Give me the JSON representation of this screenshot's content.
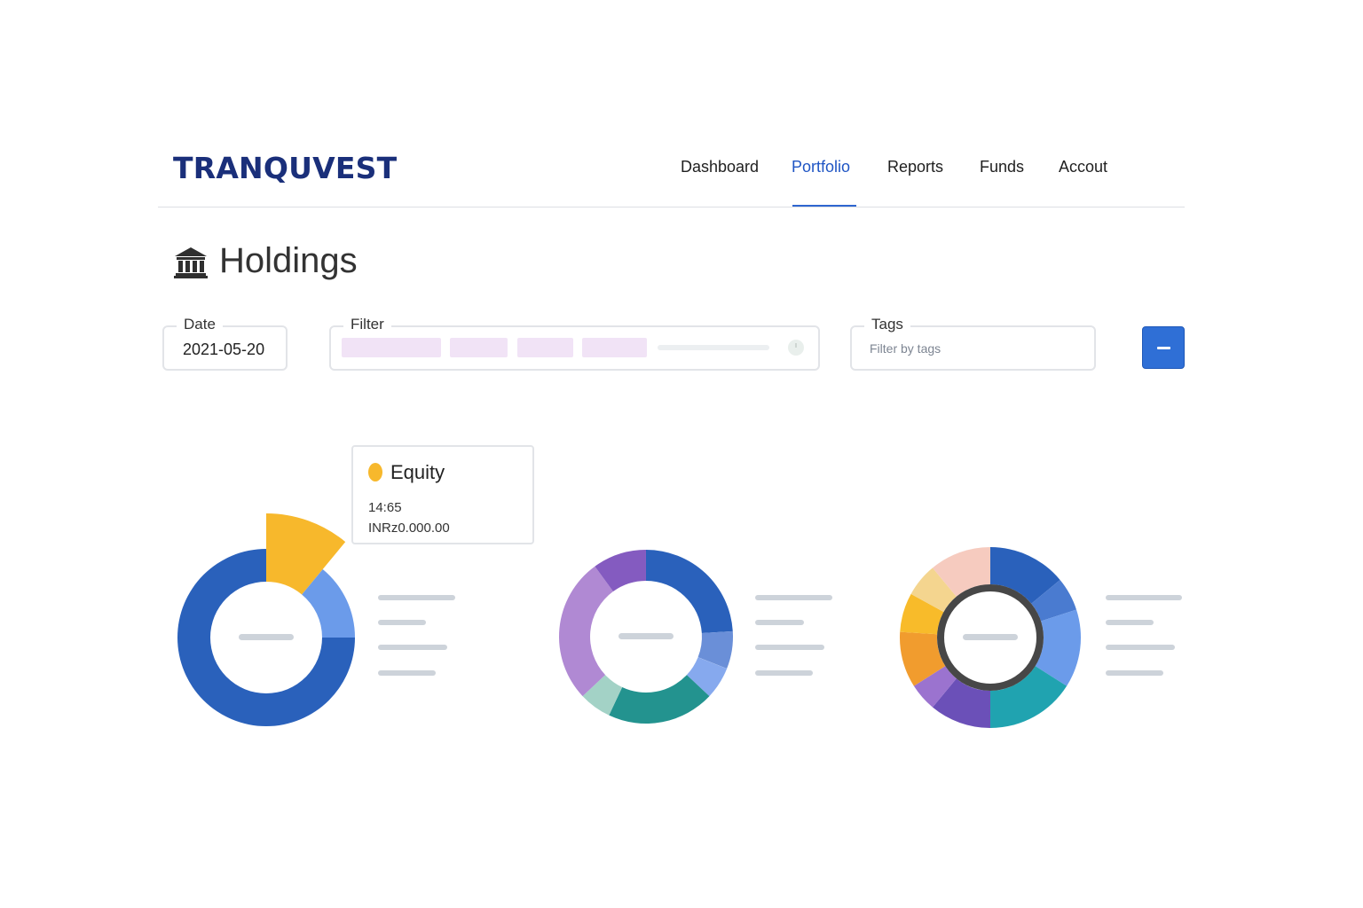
{
  "app": {
    "logo": "TRANQUVEST"
  },
  "nav": {
    "items": [
      {
        "label": "Dashboard",
        "active": false
      },
      {
        "label": "Portfolio",
        "active": true
      },
      {
        "label": "Reports",
        "active": false
      },
      {
        "label": "Funds",
        "active": false
      },
      {
        "label": "Accout",
        "active": false
      }
    ],
    "accent_color": "#2f66d0"
  },
  "page": {
    "title": "Holdings",
    "title_icon": "bank-icon"
  },
  "filters": {
    "date": {
      "label": "Date",
      "value": "2021-05-20"
    },
    "filter": {
      "label": "Filter",
      "chip_color": "#f1e3f6",
      "trailing_icon": "clock-icon"
    },
    "tags": {
      "label": "Tags",
      "placeholder": "Filter by tags"
    },
    "action_button": {
      "icon": "minus-icon",
      "color": "#2f6fd6"
    }
  },
  "tooltip": {
    "title": "Equity",
    "color": "#f7b82c",
    "line1": "14:65",
    "line2": "INRz0.000.00"
  },
  "chart_data": [
    {
      "type": "pie",
      "style": "donut",
      "highlighted_slice": 0,
      "slices": [
        {
          "value": 11,
          "color": "#f7b82c"
        },
        {
          "value": 14,
          "color": "#6b9bea"
        },
        {
          "value": 75,
          "color": "#2a61bb"
        }
      ]
    },
    {
      "type": "pie",
      "style": "donut",
      "slices": [
        {
          "value": 24,
          "color": "#2a61bb"
        },
        {
          "value": 7,
          "color": "#6a8fd8"
        },
        {
          "value": 6,
          "color": "#86a9ee"
        },
        {
          "value": 20,
          "color": "#23938f"
        },
        {
          "value": 6,
          "color": "#a3d2c6"
        },
        {
          "value": 27,
          "color": "#b089d3"
        },
        {
          "value": 10,
          "color": "#845bc0"
        }
      ]
    },
    {
      "type": "pie",
      "style": "donut",
      "center_ring_color": "#474747",
      "slices": [
        {
          "value": 14,
          "color": "#2a61bb"
        },
        {
          "value": 6,
          "color": "#4a7bd0"
        },
        {
          "value": 14,
          "color": "#6b9bea"
        },
        {
          "value": 16,
          "color": "#20a3b0"
        },
        {
          "value": 11,
          "color": "#6b50b8"
        },
        {
          "value": 5,
          "color": "#9b73cf"
        },
        {
          "value": 10,
          "color": "#f19c2e"
        },
        {
          "value": 7,
          "color": "#f8bb2a"
        },
        {
          "value": 6,
          "color": "#f4d58f"
        },
        {
          "value": 11,
          "color": "#f6cbbf"
        }
      ]
    }
  ]
}
